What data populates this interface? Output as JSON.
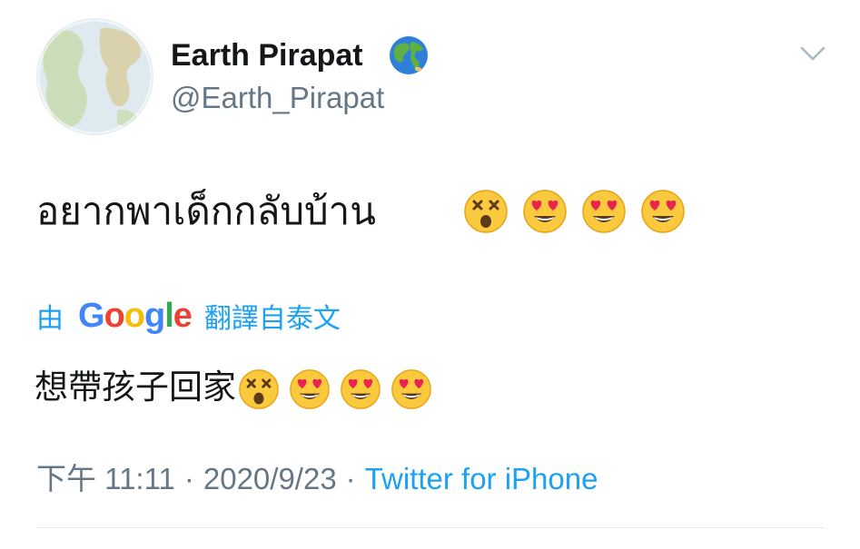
{
  "header": {
    "display_name": "Earth Pirapat",
    "handle": "@Earth_Pirapat",
    "verified_icon": "globe-emoji-icon",
    "menu_icon": "chevron-down-icon"
  },
  "tweet": {
    "text": "อยากพาเด็กกลับบ้าน",
    "emojis": [
      "dizzy-face-emoji",
      "heart-eyes-emoji",
      "heart-eyes-emoji",
      "heart-eyes-emoji"
    ]
  },
  "translation": {
    "by_label": "由",
    "provider_logo": "Google",
    "from_label": "翻譯自泰文",
    "text": "想帶孩子回家",
    "emojis": [
      "dizzy-face-emoji",
      "heart-eyes-emoji",
      "heart-eyes-emoji",
      "heart-eyes-emoji"
    ]
  },
  "meta": {
    "time": "下午 11:11",
    "separator": "·",
    "date": "2020/9/23",
    "source": "Twitter for iPhone"
  },
  "colors": {
    "link": "#1da1f2",
    "secondary": "#657786",
    "primary": "#14171a"
  }
}
